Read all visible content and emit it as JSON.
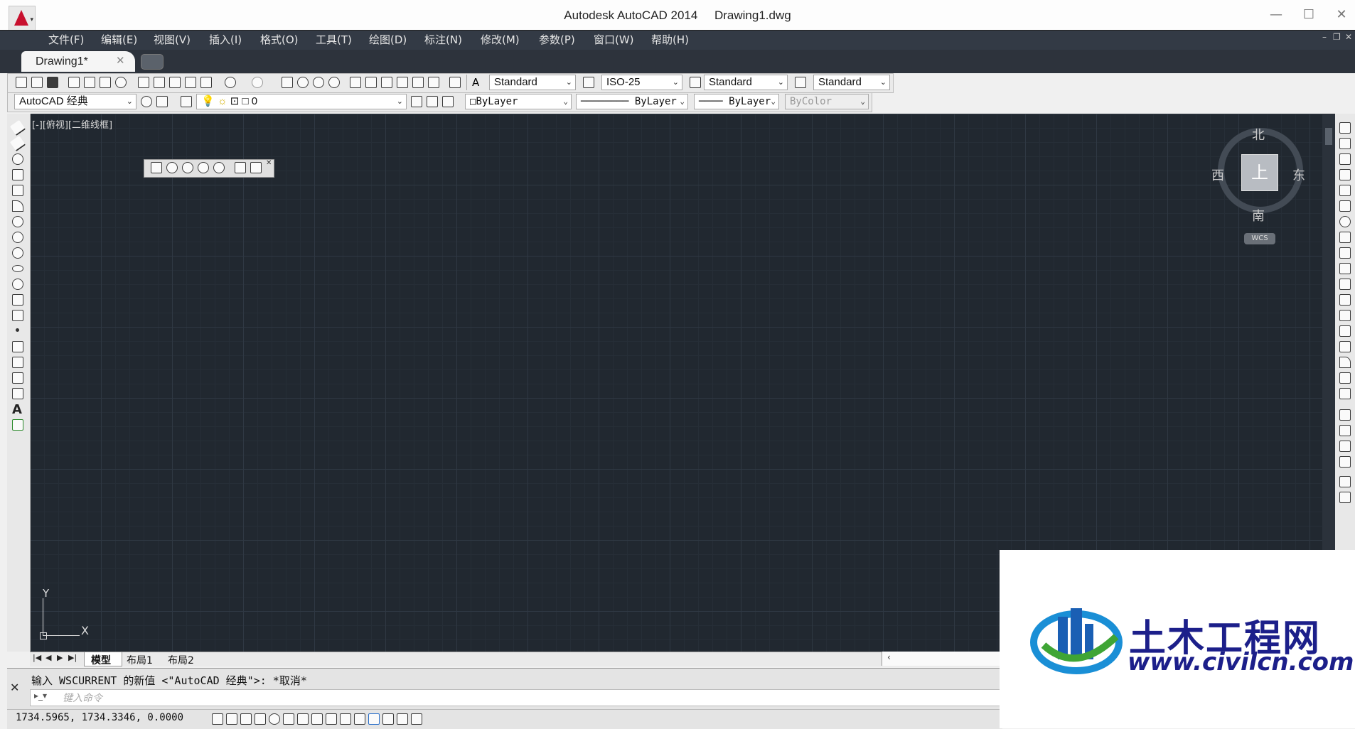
{
  "window": {
    "title": "Autodesk AutoCAD 2014     Drawing1.dwg",
    "minimize": "—",
    "maximize": "☐",
    "close": "✕"
  },
  "menu": [
    "文件(F)",
    "编辑(E)",
    "视图(V)",
    "插入(I)",
    "格式(O)",
    "工具(T)",
    "绘图(D)",
    "标注(N)",
    "修改(M)",
    "参数(P)",
    "窗口(W)",
    "帮助(H)"
  ],
  "tabs": {
    "active": "Drawing1*",
    "close": "✕"
  },
  "styles_toolbar": {
    "text_style": "Standard",
    "dim_style": "ISO-25",
    "table_style": "Standard",
    "mleader_style": "Standard"
  },
  "properties_toolbar": {
    "workspace": "AutoCAD 经典",
    "layer": "0",
    "color": "ByLayer",
    "linetype": "ByLayer",
    "lineweight": "ByLayer",
    "plotstyle": "ByColor"
  },
  "viewport": {
    "label": "[-][俯视][二维线框]"
  },
  "viewcube": {
    "north": "北",
    "south": "南",
    "east": "东",
    "west": "西",
    "face": "上",
    "wcs": "WCS"
  },
  "ucs": {
    "x": "X",
    "y": "Y"
  },
  "layout_tabs": [
    "模型",
    "布局1",
    "布局2"
  ],
  "command": {
    "history": "输入 WSCURRENT 的新值 <\"AutoCAD 经典\">: *取消*",
    "placeholder": "键入命令"
  },
  "status": {
    "coordinates": "1734.5965, 1734.3346, 0.0000"
  },
  "watermark": {
    "brand": "土木工程网",
    "url": "www.civilcn.com"
  }
}
